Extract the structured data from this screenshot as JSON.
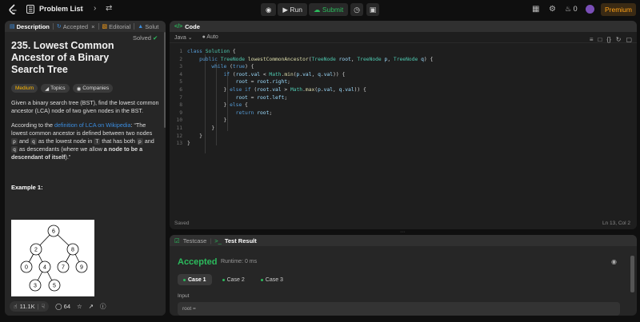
{
  "topbar": {
    "problem_list_label": "Problem List",
    "run_label": "Run",
    "submit_label": "Submit",
    "streak_count": "0",
    "premium_label": "Premium"
  },
  "left": {
    "tabs": [
      {
        "label": "Description"
      },
      {
        "label": "Accepted"
      },
      {
        "label": "Editorial"
      },
      {
        "label": "Solut"
      }
    ],
    "title": "235. Lowest Common Ancestor of a Binary Search Tree",
    "solved_label": "Solved",
    "badges": {
      "difficulty": "Medium",
      "topics": "Topics",
      "companies": "Companies"
    },
    "para1": "Given a binary search tree (BST), find the lowest common ancestor (LCA) node of two given nodes in the BST.",
    "para2_prefix": "According to the ",
    "para2_link": "definition of LCA on Wikipedia",
    "para2_a": ": “The lowest common ancestor is defined between two nodes ",
    "code_p": "p",
    "para2_and": " and ",
    "code_q": "q",
    "para2_b": " as the lowest node in ",
    "code_t": "T",
    "para2_c": " that has both ",
    "para2_d": " as descendants (where we allow ",
    "para2_bold": "a node to be a descendant of itself",
    "para2_end": ").”",
    "example_title": "Example 1:",
    "tree_nodes": [
      "6",
      "2",
      "8",
      "0",
      "4",
      "7",
      "9",
      "3",
      "5"
    ],
    "likes": "11.1K",
    "comments": "64"
  },
  "code": {
    "header": "Code",
    "language": "Java",
    "autosave": "Auto",
    "lines": [
      {
        "n": "1"
      },
      {
        "n": "2"
      },
      {
        "n": "3"
      },
      {
        "n": "4"
      },
      {
        "n": "5"
      },
      {
        "n": "6"
      },
      {
        "n": "7"
      },
      {
        "n": "8"
      },
      {
        "n": "9"
      },
      {
        "n": "10"
      },
      {
        "n": "11"
      },
      {
        "n": "12"
      },
      {
        "n": "13"
      }
    ],
    "saved_status": "Saved",
    "cursor_pos": "Ln 13, Col 2"
  },
  "test": {
    "tab_testcase": "Testcase",
    "tab_result": "Test Result",
    "status": "Accepted",
    "runtime": "Runtime: 0 ms",
    "cases": [
      "Case 1",
      "Case 2",
      "Case 3"
    ],
    "input_label": "Input",
    "input_value": "root ="
  },
  "colors": {
    "accent_green": "#2cbb5d",
    "link_blue": "#3b8ddf",
    "premium_orange": "#ffa116",
    "medium_yellow": "#ffb800"
  }
}
